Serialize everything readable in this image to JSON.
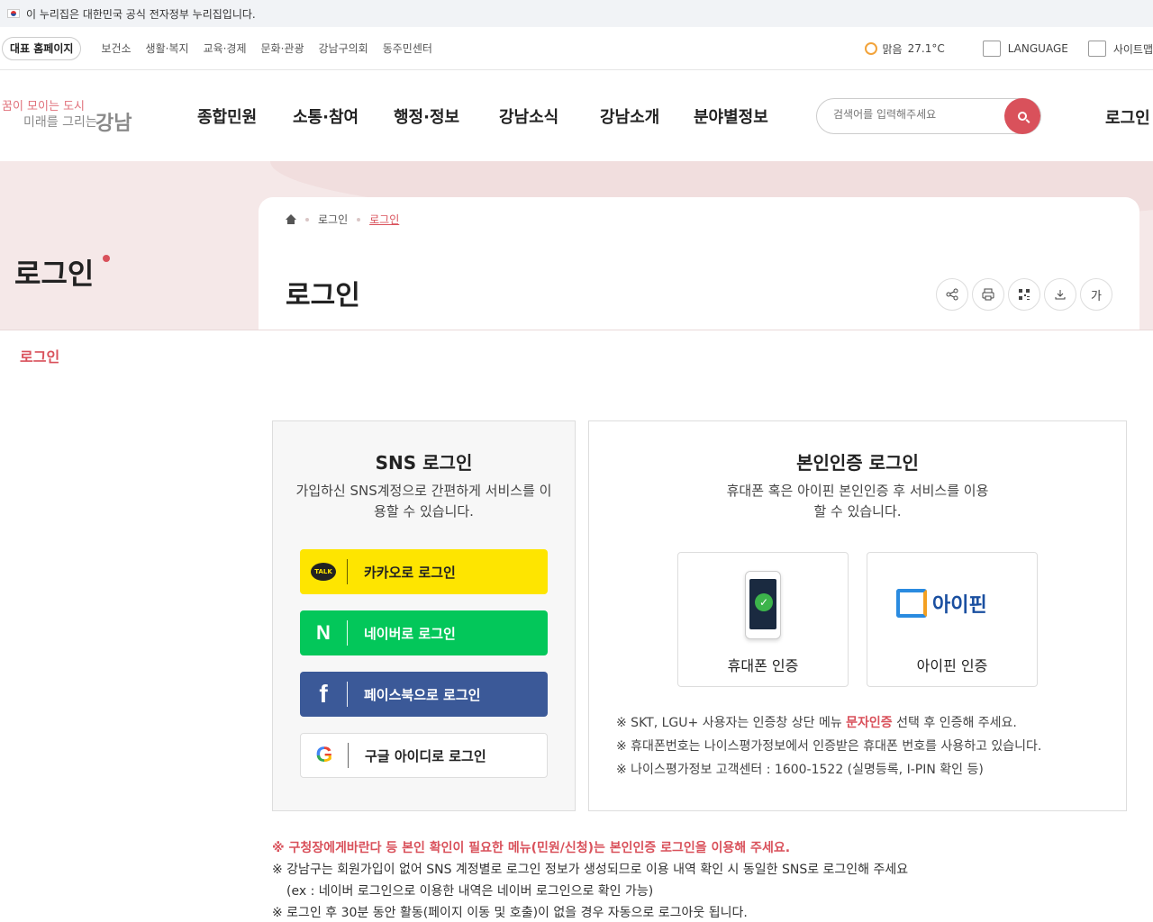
{
  "gov_banner": {
    "text": "이 누리집은 대한민국 공식 전자정부 누리집입니다."
  },
  "util": {
    "home_label": "대표 홈페이지",
    "links": [
      "보건소",
      "생활·복지",
      "교육·경제",
      "문화·관광",
      "강남구의회",
      "동주민센터"
    ],
    "weather_text": "맑음",
    "temperature": "27.1°C",
    "language": "LANGUAGE",
    "sitemap": "사이트맵"
  },
  "header": {
    "logo_line1": "꿈이 모이는 도시",
    "logo_line2": "미래를 그리는",
    "logo_big": "강남",
    "gnb": [
      "종합민원",
      "소통·참여",
      "행정·정보",
      "강남소식",
      "강남소개",
      "분야별정보"
    ],
    "search_placeholder": "검색어를 입력해주세요",
    "login": "로그인"
  },
  "hero": {
    "title": "로그인",
    "breadcrumb": [
      "로그인",
      "로그인"
    ],
    "page_title": "로그인",
    "font_tool": "가"
  },
  "side_menu": {
    "item": "로그인"
  },
  "sns": {
    "title": "SNS 로그인",
    "desc": "가입하신 SNS계정으로 간편하게 서비스를 이용할 수 있습니다.",
    "talk_text": "TALK",
    "kakao": "카카오로 로그인",
    "naver": "네이버로 로그인",
    "facebook": "페이스북으로 로그인",
    "google": "구글 아이디로 로그인"
  },
  "id_login": {
    "title": "본인인증 로그인",
    "desc": "휴대폰 혹은 아이핀 본인인증 후 서비스를 이용할 수 있습니다.",
    "phone_label": "휴대폰 인증",
    "ipin_label": "아이핀 인증",
    "ipin_logo": "아이핀",
    "note1_a": "※ SKT, LGU+ 사용자는 인증창 상단 메뉴 ",
    "note1_hl": "문자인증",
    "note1_b": " 선택 후 인증해 주세요.",
    "note2": "※ 휴대폰번호는 나이스평가정보에서 인증받은 휴대폰 번호를 사용하고 있습니다.",
    "note3": "※ 나이스평가정보 고객센터 : 1600-1522 (실명등록, I-PIN 확인 등)"
  },
  "notice": {
    "line1": "※ 구청장에게바란다 등 본인 확인이 필요한 메뉴(민원/신청)는 본인인증 로그인을 이용해 주세요.",
    "line2": "※ 강남구는 회원가입이 없어 SNS 계정별로 로그인 정보가 생성되므로 이용 내역 확인 시 동일한 SNS로 로그인해 주세요",
    "line3": "(ex : 네이버 로그인으로 이용한 내역은 네이버 로그인으로 확인 가능)",
    "line4": "※ 로그인 후 30분 동안 활동(페이지 이동 및 호출)이 없을 경우 자동으로 로그아웃 됩니다."
  },
  "colors": {
    "accent": "#d9515b",
    "kakao": "#fee500",
    "naver": "#03c75a",
    "facebook": "#3b5998"
  }
}
